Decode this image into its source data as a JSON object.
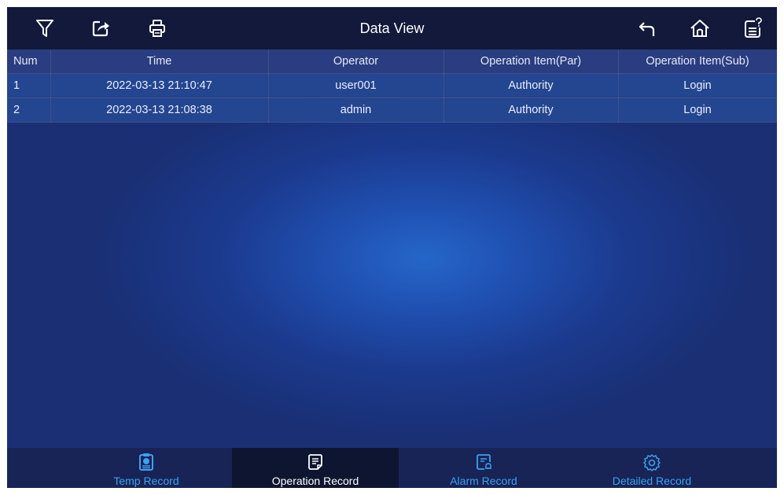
{
  "header": {
    "title": "Data View",
    "left_icons": [
      "filter-icon",
      "export-icon",
      "print-icon"
    ],
    "right_icons": [
      "back-icon",
      "home-icon",
      "help-icon"
    ]
  },
  "table": {
    "columns": [
      "Num",
      "Time",
      "Operator",
      "Operation Item(Par)",
      "Operation Item(Sub)"
    ],
    "rows": [
      [
        "1",
        "2022-03-13 21:10:47",
        "user001",
        "Authority",
        "Login"
      ],
      [
        "2",
        "2022-03-13 21:08:38",
        "admin",
        "Authority",
        "Login"
      ]
    ]
  },
  "tabs": [
    {
      "label": "Temp Record",
      "icon": "temp-record-icon",
      "active": false
    },
    {
      "label": "Operation Record",
      "icon": "operation-record-icon",
      "active": true
    },
    {
      "label": "Alarm Record",
      "icon": "alarm-record-icon",
      "active": false
    },
    {
      "label": "Detailed Record",
      "icon": "settings-gear-icon",
      "active": false
    }
  ],
  "colors": {
    "topbar": "#12193a",
    "accent": "#3ea0f0",
    "active_tab_bg": "#0e1530"
  }
}
